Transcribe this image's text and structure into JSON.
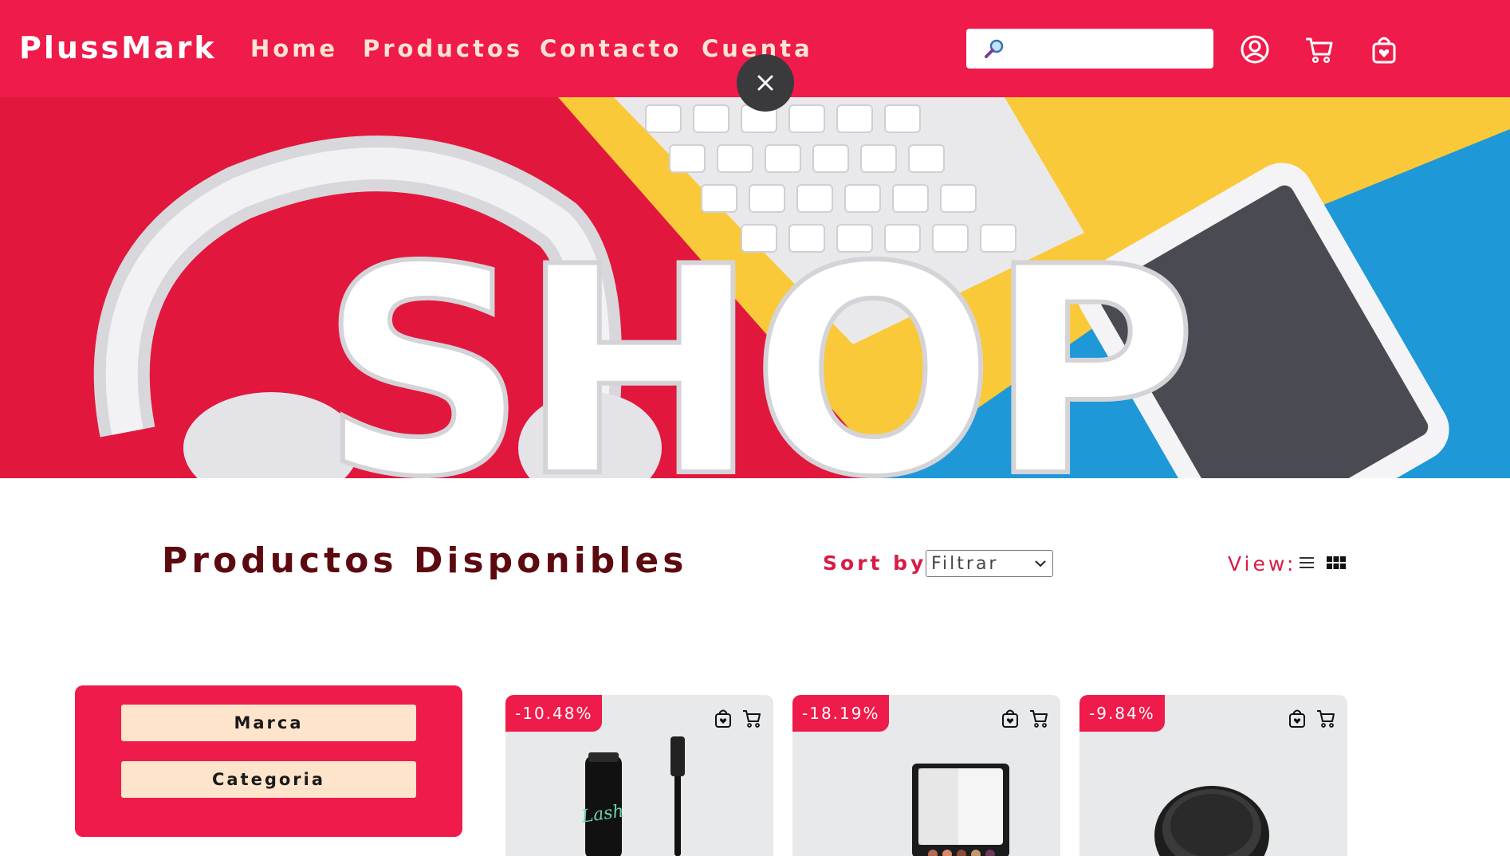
{
  "navbar": {
    "brand": "PlussMark",
    "links": [
      "Home",
      "Productos",
      "Contacto",
      "Cuenta"
    ],
    "search_placeholder": "",
    "icons": [
      "user-icon",
      "cart-icon",
      "shopping-bag-icon"
    ]
  },
  "hero": {
    "text": "SHOP"
  },
  "products_header": {
    "title": "Productos Disponibles",
    "sort_label": "Sort by:",
    "sort_selected": "Filtrar",
    "view_label": "View:"
  },
  "filters": {
    "buttons": [
      "Marca",
      "Categoria"
    ]
  },
  "products": [
    {
      "discount": "-10.48%",
      "image": "mascara"
    },
    {
      "discount": "-18.19%",
      "image": "eyeshadow-palette"
    },
    {
      "discount": "-9.84%",
      "image": "compact-powder"
    }
  ],
  "colors": {
    "brand_red": "#ef1b4a",
    "nav_link": "#ffe4cf",
    "title": "#5c0a10",
    "filter_button_bg": "#ffe4cc",
    "card_bg": "#e8e9ea"
  }
}
